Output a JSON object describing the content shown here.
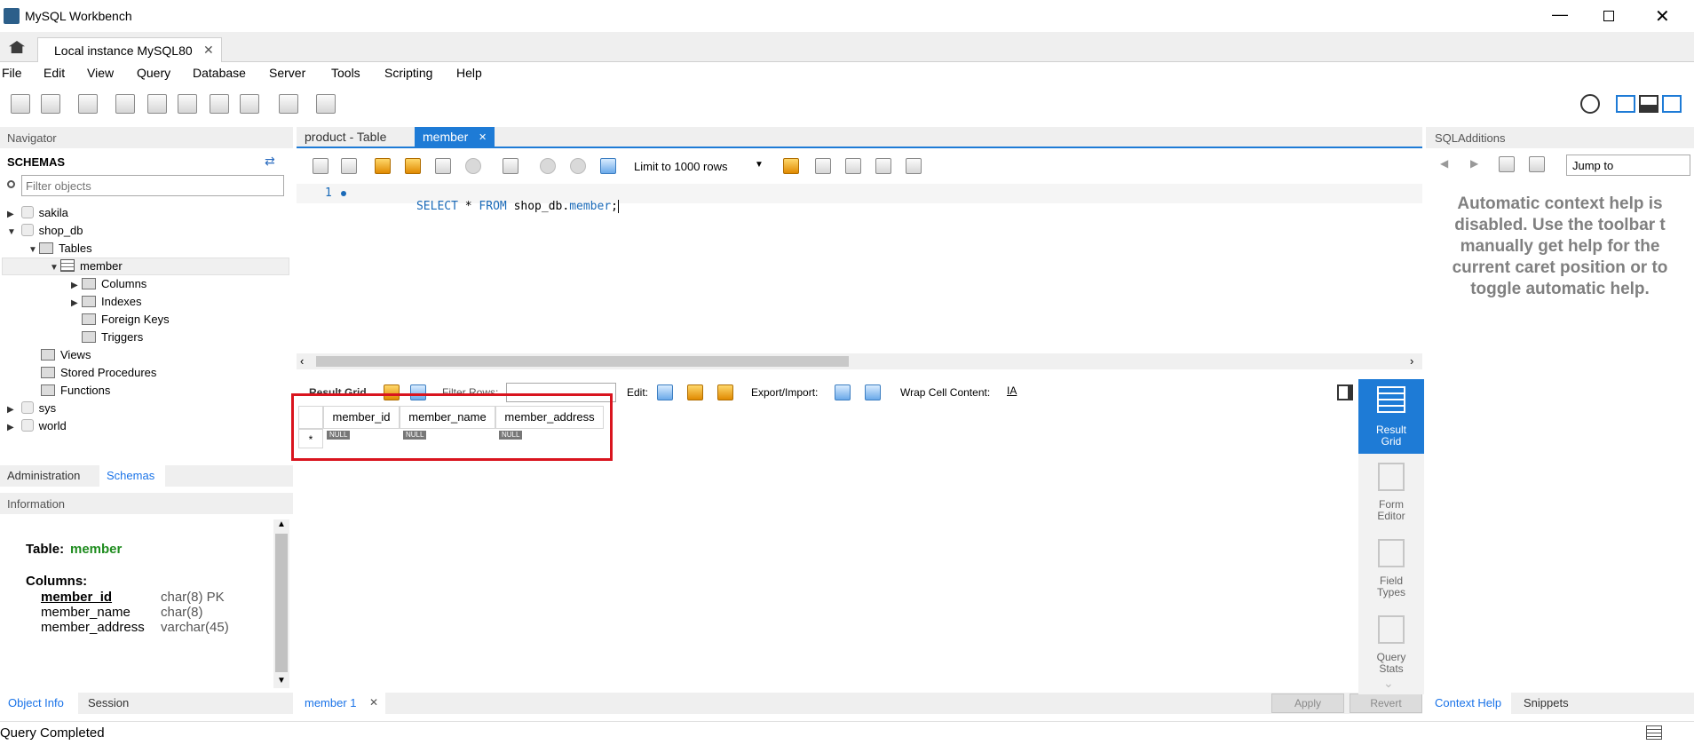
{
  "window": {
    "title": "MySQL Workbench"
  },
  "tabs": {
    "connection_tab": "Local instance MySQL80"
  },
  "menu": [
    "File",
    "Edit",
    "View",
    "Query",
    "Database",
    "Server",
    "Tools",
    "Scripting",
    "Help"
  ],
  "navigator": {
    "header": "Navigator",
    "schemas_label": "SCHEMAS",
    "filter_placeholder": "Filter objects",
    "tree": {
      "sakila": "sakila",
      "shop_db": "shop_db",
      "tables": "Tables",
      "member": "member",
      "columns": "Columns",
      "indexes": "Indexes",
      "foreign_keys": "Foreign Keys",
      "triggers": "Triggers",
      "views": "Views",
      "stored_procedures": "Stored Procedures",
      "functions": "Functions",
      "sys": "sys",
      "world": "world"
    },
    "bottom_tabs": {
      "administration": "Administration",
      "schemas": "Schemas"
    }
  },
  "information": {
    "header": "Information",
    "table_label": "Table:",
    "table_name": "member",
    "columns_label": "Columns:",
    "columns": [
      {
        "name": "member_id",
        "type": "char(8) PK"
      },
      {
        "name": "member_name",
        "type": "char(8)"
      },
      {
        "name": "member_address",
        "type": "varchar(45)"
      }
    ],
    "bottom_tabs": {
      "object_info": "Object Info",
      "session": "Session"
    }
  },
  "editor": {
    "tabs": {
      "product": "product - Table",
      "member": "member"
    },
    "limit_select": "Limit to 1000 rows",
    "line_number": "1",
    "sql": {
      "kw1": "SELECT",
      "star": "*",
      "kw2": "FROM",
      "schema": "shop_db.",
      "table": "member",
      "end": ";"
    }
  },
  "result": {
    "toolbar": {
      "result_grid": "Result Grid",
      "filter_rows": "Filter Rows:",
      "edit": "Edit:",
      "export_import": "Export/Import:",
      "wrap": "Wrap Cell Content:"
    },
    "columns": [
      "member_id",
      "member_name",
      "member_address"
    ],
    "null_text": "NULL",
    "new_row_marker": "*",
    "bottom_tab": "member 1",
    "apply": "Apply",
    "revert": "Revert"
  },
  "side_views": {
    "result_grid": [
      "Result",
      "Grid"
    ],
    "form_editor": [
      "Form",
      "Editor"
    ],
    "field_types": [
      "Field",
      "Types"
    ],
    "query_stats": [
      "Query",
      "Stats"
    ]
  },
  "sql_additions": {
    "header": "SQLAdditions",
    "jump_to": "Jump to",
    "help_lines": [
      "Automatic context help is",
      "disabled. Use the toolbar t",
      "manually get help for the",
      "current caret position or to",
      "toggle automatic help."
    ],
    "bottom_tabs": {
      "context_help": "Context Help",
      "snippets": "Snippets"
    }
  },
  "status": {
    "text": "Query Completed"
  },
  "colors": {
    "accent": "#1a73e8",
    "tab_active": "#1e7bd6",
    "highlight_red": "#d9141e",
    "table_green": "#1f8c1f",
    "keyword": "#1a6ab8"
  }
}
